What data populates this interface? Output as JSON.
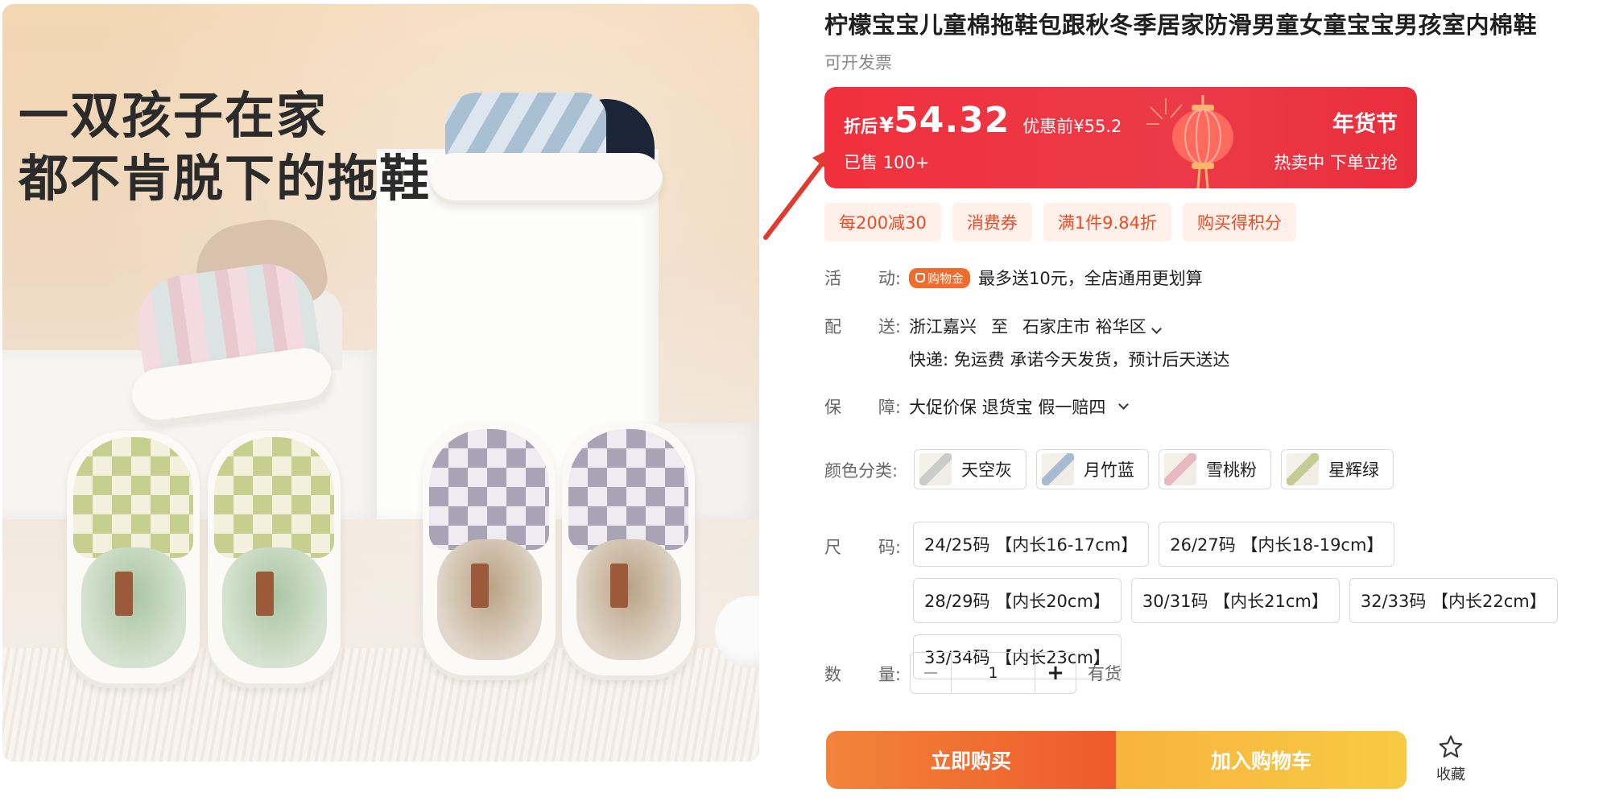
{
  "hero": {
    "line1": "一双孩子在家",
    "line2": "都不肯脱下的拖鞋"
  },
  "product": {
    "title": "柠檬宝宝儿童棉拖鞋包跟秋冬季居家防滑男童女童宝宝男孩室内棉鞋",
    "invoice": "可开发票"
  },
  "price": {
    "after_label": "折后",
    "currency": "¥",
    "value": "54.32",
    "before": "优惠前¥55.2",
    "sold": "已售 100+",
    "festival": "年货节",
    "hot": "热卖中  下单立抢",
    "accent_color": "#ef2f3d"
  },
  "coupons": [
    "每200减30",
    "消费券",
    "满1件9.84折",
    "购买得积分"
  ],
  "activity": {
    "label_a": "活",
    "label_b": "动:",
    "badge": "购物金",
    "text": "最多送10元，全店通用更划算"
  },
  "delivery": {
    "label_a": "配",
    "label_b": "送:",
    "from": "浙江嘉兴",
    "to_word": "至",
    "to": "石家庄市 裕华区",
    "line2": "快递: 免运费  承诺今天发货，预计后天送达"
  },
  "guarantee": {
    "label_a": "保",
    "label_b": "障:",
    "text": "大促价保 退货宝 假一赔四"
  },
  "colors": {
    "label": "颜色分类:",
    "options": [
      "天空灰",
      "月竹蓝",
      "雪桃粉",
      "星辉绿"
    ]
  },
  "sizes": {
    "label_a": "尺",
    "label_b": "码:",
    "options": [
      "24/25码 【内长16-17cm】",
      "26/27码 【内长18-19cm】",
      "28/29码 【内长20cm】",
      "30/31码 【内长21cm】",
      "32/33码 【内长22cm】",
      "33/34码 【内长23cm】"
    ]
  },
  "quantity": {
    "label_a": "数",
    "label_b": "量:",
    "minus": "−",
    "value": "1",
    "plus": "+",
    "stock": "有货"
  },
  "actions": {
    "buy_now": "立即购买",
    "add_cart": "加入购物车",
    "favorite": "收藏",
    "favorite_icon": "star-icon"
  }
}
